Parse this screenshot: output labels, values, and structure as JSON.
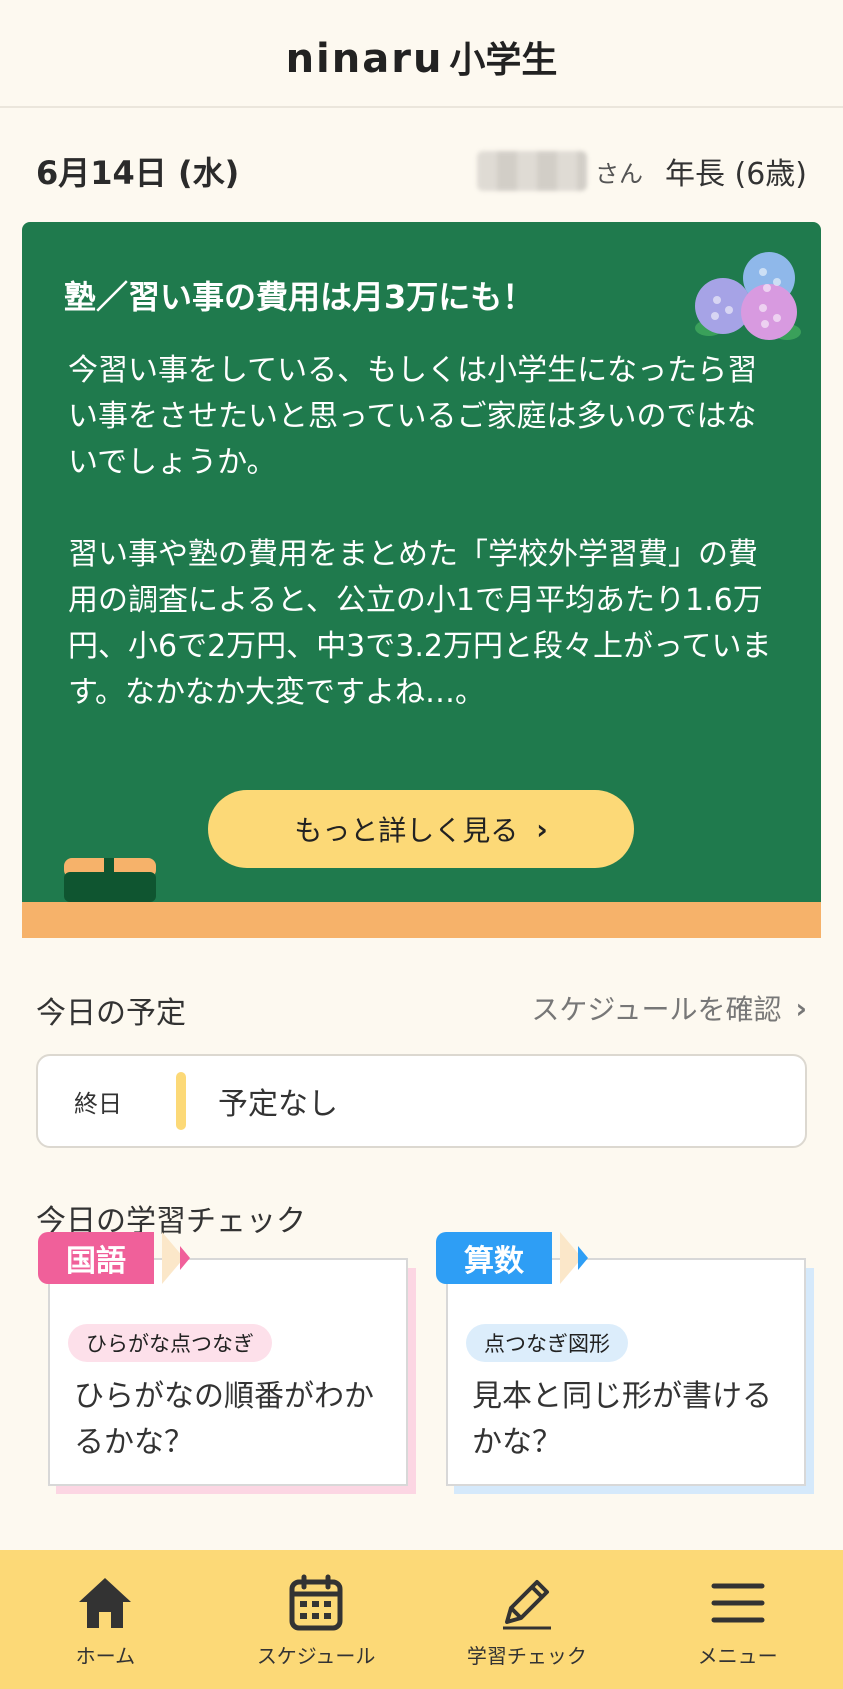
{
  "header": {
    "logo_en": "ninaru",
    "logo_jp": "小学生"
  },
  "date_row": {
    "date": "6月14日 (水)",
    "name_suffix": "さん",
    "grade": "年長 (6歳)"
  },
  "feature": {
    "title": "塾／習い事の費用は月3万にも！",
    "paragraph1": "今習い事をしている、もしくは小学生になったら習い事をさせたいと思っているご家庭は多いのではないでしょうか。",
    "paragraph2": "習い事や塾の費用をまとめた「学校外学習費」の費用の調査によると、公立の小1で月平均あたり1.6万円、小6で2万円、中3で3.2万円と段々上がっています。なかなか大変ですよね…。",
    "button_label": "もっと詳しく見る"
  },
  "schedule": {
    "title": "今日の予定",
    "link_label": "スケジュールを確認",
    "time_label": "終日",
    "entry": "予定なし"
  },
  "study_check": {
    "title": "今日の学習チェック",
    "cards": [
      {
        "subject": "国語",
        "category": "ひらがな点つなぎ",
        "question": "ひらがなの順番がわかるかな？"
      },
      {
        "subject": "算数",
        "category": "点つなぎ図形",
        "question": "見本と同じ形が書けるかな？"
      }
    ]
  },
  "nav": {
    "items": [
      {
        "label": "ホーム",
        "icon": "home-icon"
      },
      {
        "label": "スケジュール",
        "icon": "calendar-icon"
      },
      {
        "label": "学習チェック",
        "icon": "pencil-icon"
      },
      {
        "label": "メニュー",
        "icon": "menu-icon"
      }
    ]
  },
  "colors": {
    "background": "#fdf9f0",
    "board_green": "#1f7a4d",
    "accent_yellow": "#fcd977",
    "ledge_orange": "#f6b26a",
    "japanese_pink": "#f0609a",
    "math_blue": "#2e9ef5"
  }
}
